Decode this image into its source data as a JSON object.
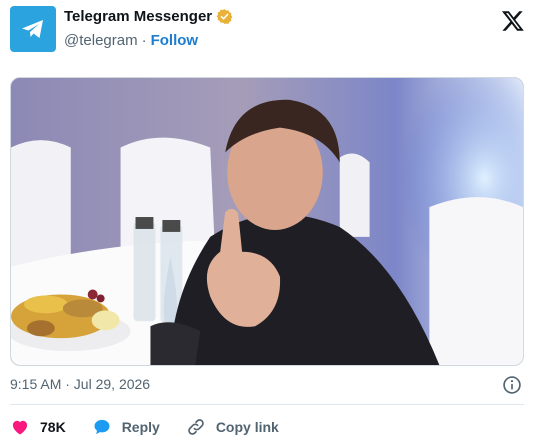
{
  "author": {
    "display_name": "Telegram Messenger",
    "handle": "@telegram",
    "separator": "·",
    "follow_label": "Follow",
    "avatar_color": "#2aa3df",
    "verified_color": "#e8b13a"
  },
  "platform_icon": "x-logo-icon",
  "media": {
    "icon": "photo"
  },
  "timestamp": "9:15 AM · Jul 29, 2026",
  "actions": {
    "like_count": "78K",
    "reply_label": "Reply",
    "copy_link_label": "Copy link"
  },
  "colors": {
    "like": "#f91880",
    "reply": "#1d9bf0",
    "link": "#1d7dd0",
    "muted": "#536471"
  }
}
